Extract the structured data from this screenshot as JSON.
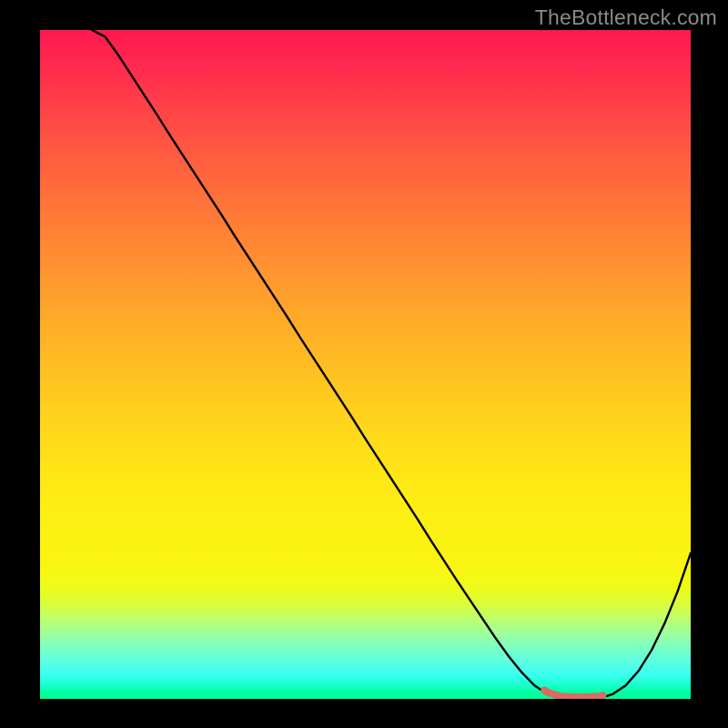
{
  "watermark": {
    "text": "TheBottleneck.com"
  },
  "colors": {
    "frame": "#000000",
    "curve_stroke": "#000000",
    "highlight_stroke": "#d86b63",
    "gradient_top": "#ff1850",
    "gradient_bottom": "#00ff93"
  },
  "chart_data": {
    "type": "line",
    "title": "",
    "xlabel": "",
    "ylabel": "",
    "xlim": [
      0,
      100
    ],
    "ylim": [
      0,
      100
    ],
    "x": [
      0,
      2,
      4,
      6,
      8,
      10,
      12,
      14,
      16,
      18,
      20,
      22,
      24,
      26,
      28,
      30,
      32,
      34,
      36,
      38,
      40,
      42,
      44,
      46,
      48,
      50,
      52,
      54,
      56,
      58,
      60,
      62,
      64,
      66,
      68,
      70,
      72,
      74,
      76,
      78,
      80,
      82,
      84,
      86,
      88,
      90,
      92,
      94,
      96,
      98,
      100
    ],
    "series": [
      {
        "name": "curve",
        "values": [
          100,
          100,
          100,
          100,
          100,
          99,
          96.3,
          93.3,
          90.3,
          87.3,
          84.2,
          81.2,
          78.2,
          75.2,
          72.2,
          69.1,
          66.1,
          63.1,
          60.1,
          57.1,
          54.0,
          51.0,
          48.0,
          45.0,
          42.0,
          38.9,
          35.9,
          32.9,
          29.9,
          26.9,
          23.8,
          20.8,
          17.8,
          14.9,
          12.0,
          9.1,
          6.4,
          4.0,
          2.0,
          0.7,
          0.1,
          0.0,
          0.0,
          0.1,
          0.7,
          2.0,
          4.2,
          7.3,
          11.3,
          16.1,
          21.8
        ]
      }
    ],
    "highlight": {
      "x_range": [
        77.5,
        86.5
      ],
      "approx_y": 0.3,
      "color": "#d86b63"
    }
  }
}
